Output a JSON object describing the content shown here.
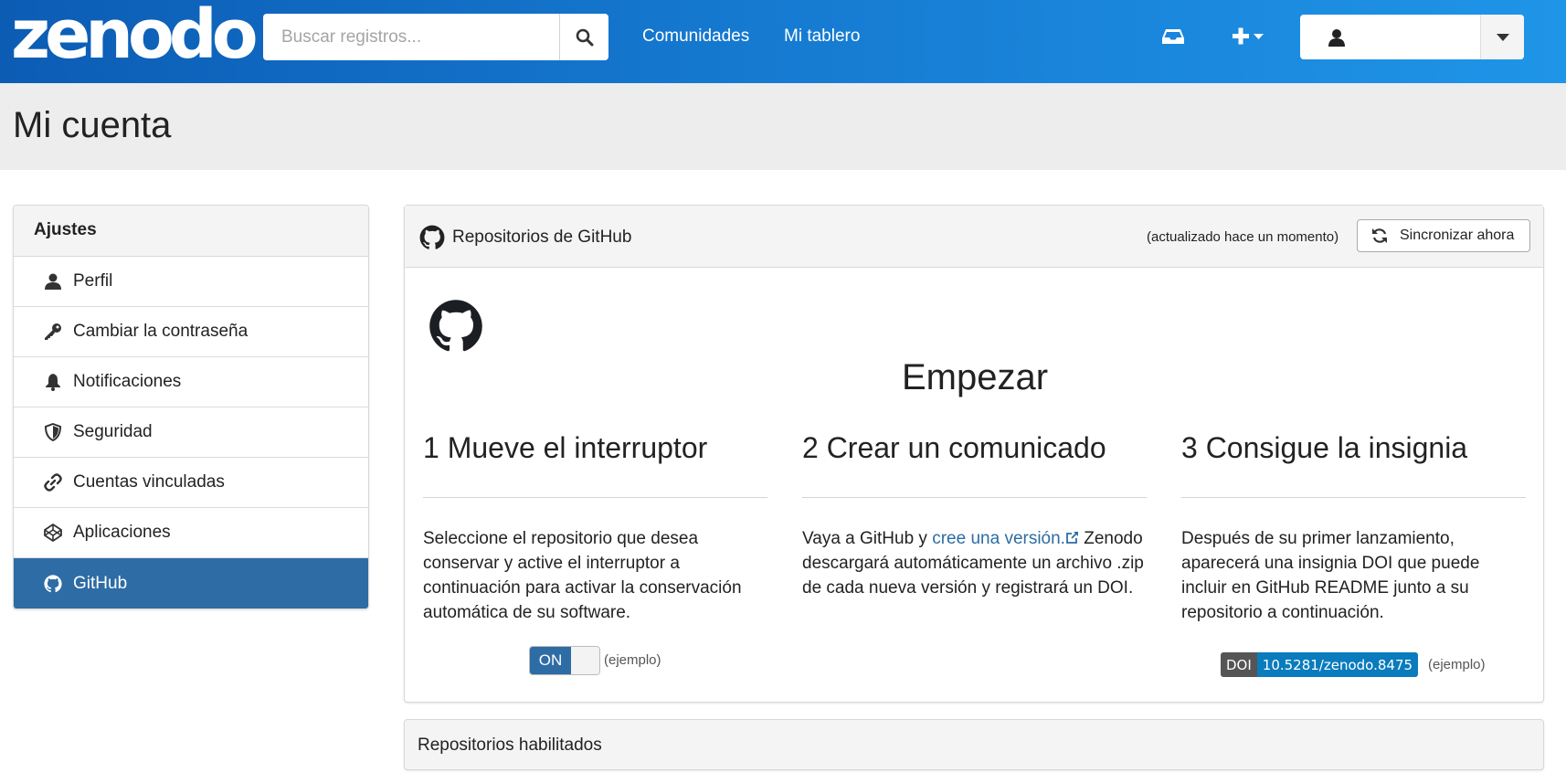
{
  "header": {
    "logo": "zenodo",
    "search": {
      "placeholder": "Buscar registros..."
    },
    "nav": [
      "Comunidades",
      "Mi tablero"
    ],
    "icons": {
      "search": "search-icon",
      "inbox": "inbox-icon",
      "new": "plus-icon",
      "user": "user-icon",
      "dropdown": "caret-down-icon"
    }
  },
  "page": {
    "title": "Mi cuenta"
  },
  "sidebar": {
    "heading": "Ajustes",
    "items": [
      {
        "label": "Perfil",
        "icon": "user-icon"
      },
      {
        "label": "Cambiar la contraseña",
        "icon": "key-icon"
      },
      {
        "label": "Notificaciones",
        "icon": "bell-icon"
      },
      {
        "label": "Seguridad",
        "icon": "shield-icon"
      },
      {
        "label": "Cuentas vinculadas",
        "icon": "link-icon"
      },
      {
        "label": "Aplicaciones",
        "icon": "codepen-icon"
      },
      {
        "label": "GitHub",
        "icon": "github-icon",
        "active": true
      }
    ]
  },
  "github_panel": {
    "title": "Repositorios de GitHub",
    "updated": "(actualizado hace un momento)",
    "sync_label": "Sincronizar ahora",
    "heading": "Empezar",
    "steps": [
      {
        "title": "1 Mueve el interruptor",
        "text": "Seleccione el repositorio que desea conservar y active el interruptor a continuación para activar la conservación automática de su software."
      },
      {
        "title": "2 Crear un comunicado",
        "text_before": "Vaya a GitHub y ",
        "link": "cree una versión.",
        "text_after": " Zenodo descargará automáticamente un archivo .zip de cada nueva versión y registrará un DOI."
      },
      {
        "title": "3 Consigue la insignia",
        "text": "Después de su primer lanzamiento, aparecerá una insignia DOI que puede incluir en GitHub README junto a su repositorio a continuación."
      }
    ],
    "toggle_label": "ON",
    "example": "(ejemplo)",
    "badge": {
      "left": "DOI",
      "right": "10.5281/zenodo.8475"
    }
  },
  "enabled_panel": {
    "title": "Repositorios habilitados"
  },
  "colors": {
    "accent": "#2e6ca5",
    "header_start": "#0c5cb4",
    "header_end": "#1f95e8",
    "doi_blue": "#0a7bbd"
  }
}
